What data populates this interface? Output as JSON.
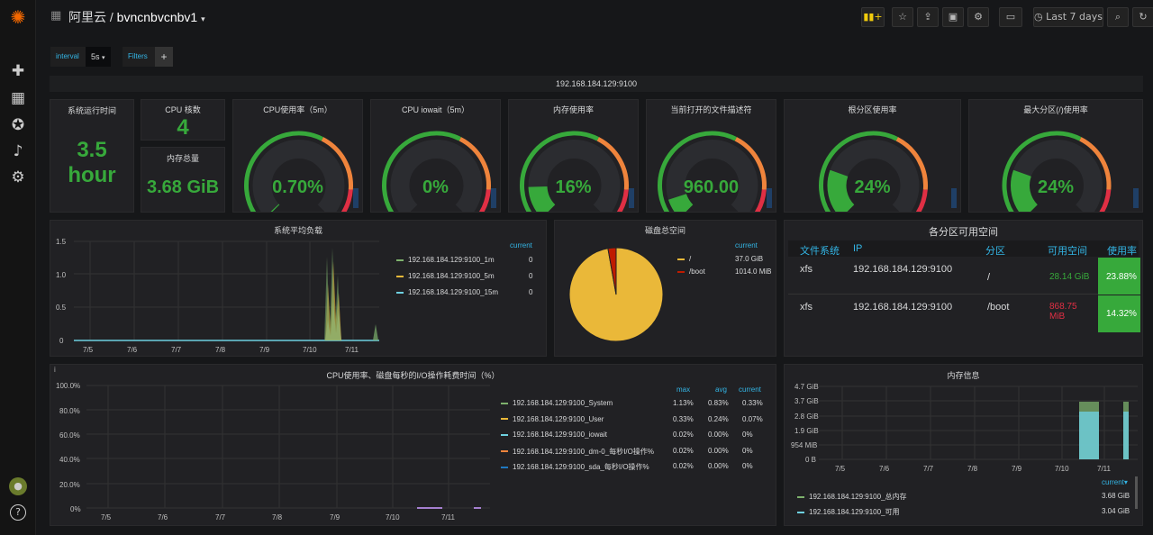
{
  "nav": {
    "org": "阿里云",
    "dashboard": "bvncnbvcnbv1",
    "time_range": "Last 7 days"
  },
  "variables": {
    "interval_label": "interval",
    "interval_value": "5s",
    "filters_label": "Filters",
    "add": "+"
  },
  "row_title": "192.168.184.129:9100",
  "stats": {
    "uptime": {
      "title": "系统运行时间",
      "value": "3.5",
      "unit": "hour"
    },
    "cpu_cores": {
      "title": "CPU 核数",
      "value": "4"
    },
    "mem_total": {
      "title": "内存总量",
      "value": "3.68 GiB"
    }
  },
  "gauges": [
    {
      "title": "CPU使用率（5m）",
      "value": "0.70%",
      "fraction": 0.007
    },
    {
      "title": "CPU iowait（5m）",
      "value": "0%",
      "fraction": 0.0
    },
    {
      "title": "内存使用率",
      "value": "16%",
      "fraction": 0.16
    },
    {
      "title": "当前打开的文件描述符",
      "value": "960.00",
      "fraction": 0.1
    },
    {
      "title": "根分区使用率",
      "value": "24%",
      "fraction": 0.24
    },
    {
      "title": "最大分区(/)使用率",
      "value": "24%",
      "fraction": 0.24
    }
  ],
  "load_panel": {
    "title": "系统平均负载",
    "current_label": "current",
    "legend": [
      {
        "name": "192.168.184.129:9100_1m",
        "value": "0",
        "color": "#7eb26d"
      },
      {
        "name": "192.168.184.129:9100_5m",
        "value": "0",
        "color": "#eab839"
      },
      {
        "name": "192.168.184.129:9100_15m",
        "value": "0",
        "color": "#6ed0e0"
      }
    ]
  },
  "disk_panel": {
    "title": "磁盘总空间",
    "current_label": "current",
    "legend": [
      {
        "name": "/",
        "value": "37.0 GiB",
        "color": "#eab839"
      },
      {
        "name": "/boot",
        "value": "1014.0 MiB",
        "color": "#bf1b00"
      }
    ]
  },
  "partition_table": {
    "title": "各分区可用空间",
    "headers": [
      "文件系统",
      "IP",
      "分区",
      "可用空间",
      "使用率"
    ],
    "rows": [
      [
        "xfs",
        "192.168.184.129:9100",
        "/",
        "28.14 GiB",
        "23.88%"
      ],
      [
        "xfs",
        "192.168.184.129:9100",
        "/boot",
        "868.75 MiB",
        "14.32%"
      ]
    ]
  },
  "cpu_io_panel": {
    "title": "CPU使用率、磁盘每秒的I/O操作耗费时间（%）",
    "headers": [
      "max",
      "avg",
      "current"
    ],
    "legend": [
      {
        "name": "192.168.184.129:9100_System",
        "max": "1.13%",
        "avg": "0.83%",
        "current": "0.33%",
        "color": "#7eb26d"
      },
      {
        "name": "192.168.184.129:9100_User",
        "max": "0.33%",
        "avg": "0.24%",
        "current": "0.07%",
        "color": "#eab839"
      },
      {
        "name": "192.168.184.129:9100_iowait",
        "max": "0.02%",
        "avg": "0.00%",
        "current": "0%",
        "color": "#6ed0e0"
      },
      {
        "name": "192.168.184.129:9100_dm-0_每秒I/O操作%",
        "max": "0.02%",
        "avg": "0.00%",
        "current": "0%",
        "color": "#ef843c"
      },
      {
        "name": "192.168.184.129:9100_sda_每秒I/O操作%",
        "max": "0.02%",
        "avg": "0.00%",
        "current": "0%",
        "color": "#1f78c1"
      }
    ]
  },
  "mem_panel": {
    "title": "内存信息",
    "current_label": "current▾",
    "legend": [
      {
        "name": "192.168.184.129:9100_总内存",
        "value": "3.68 GiB",
        "color": "#7eb26d"
      },
      {
        "name": "192.168.184.129:9100_可用",
        "value": "3.04 GiB",
        "color": "#6ed0e0"
      }
    ]
  },
  "chart_data": [
    {
      "type": "line",
      "title": "系统平均负载",
      "categories": [
        "7/5",
        "7/6",
        "7/7",
        "7/8",
        "7/9",
        "7/10",
        "7/11"
      ],
      "ylim": [
        0,
        1.5
      ],
      "yticks": [
        "0",
        "0.5",
        "1.0",
        "1.5"
      ]
    },
    {
      "type": "pie",
      "title": "磁盘总空间",
      "categories": [
        "/",
        "/boot"
      ],
      "values": [
        37.0,
        0.99
      ]
    },
    {
      "type": "line",
      "title": "CPU使用率、磁盘每秒的I/O操作耗费时间（%）",
      "categories": [
        "7/5",
        "7/6",
        "7/7",
        "7/8",
        "7/9",
        "7/10",
        "7/11"
      ],
      "yticks": [
        "0%",
        "20.0%",
        "40.0%",
        "60.0%",
        "80.0%",
        "100.0%"
      ]
    },
    {
      "type": "area",
      "title": "内存信息",
      "categories": [
        "7/5",
        "7/6",
        "7/7",
        "7/8",
        "7/9",
        "7/10",
        "7/11"
      ],
      "yticks": [
        "0 B",
        "954 MiB",
        "1.9 GiB",
        "2.8 GiB",
        "3.7 GiB",
        "4.7 GiB"
      ]
    }
  ]
}
